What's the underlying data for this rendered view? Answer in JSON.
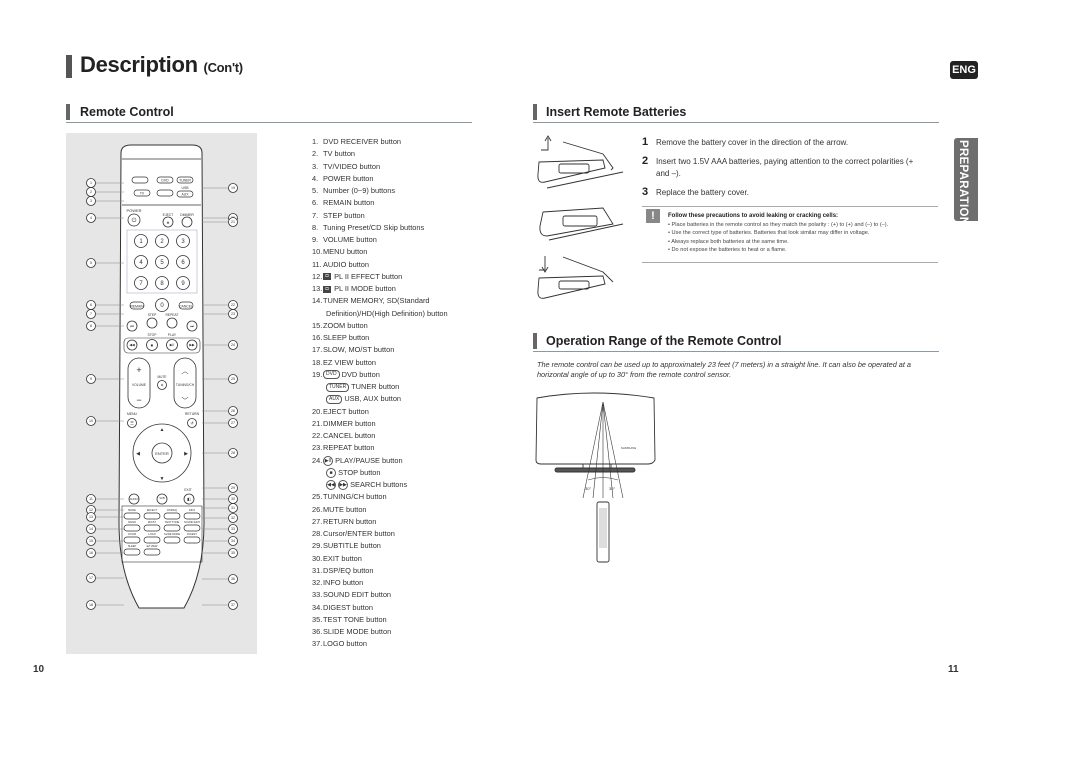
{
  "page": {
    "title": "Description",
    "title_suffix": "(Con't)",
    "language_badge": "ENG",
    "side_tab": "PREPARATION",
    "page_left": "10",
    "page_right": "11"
  },
  "remote_control": {
    "heading": "Remote Control",
    "callouts_left": [
      "1",
      "2",
      "3",
      "4",
      "5",
      "6",
      "7",
      "8",
      "9",
      "10",
      "11",
      "12",
      "13",
      "14",
      "15",
      "16",
      "17",
      "18"
    ],
    "callouts_right": [
      "19",
      "20",
      "21",
      "22",
      "23",
      "24",
      "25",
      "26",
      "27",
      "28",
      "29",
      "30",
      "31",
      "32",
      "33",
      "34",
      "35",
      "36",
      "37"
    ],
    "remote_labels": {
      "top_buttons": [
        "DVD",
        "TUNER",
        "USB",
        "AUX",
        "TV"
      ],
      "power": "POWER",
      "eject": "EJECT",
      "dimmer": "DIMMER",
      "digits": [
        "1",
        "2",
        "3",
        "4",
        "5",
        "6",
        "7",
        "8",
        "9",
        "0"
      ],
      "remain": "REMAIN",
      "cancel": "CANCEL",
      "step": "STEP",
      "repeat": "REPEAT",
      "stop": "STOP",
      "play": "PLAY",
      "mute": "MUTE",
      "volume": "VOLUME",
      "tuning": "TUNING/CH",
      "menu": "MENU",
      "return": "RETURN",
      "enter": "ENTER",
      "exit": "EXIT",
      "audio": "AUDIO",
      "subtitle": "SUB TITLE",
      "bottom_grid": [
        "MODE",
        "EFFECT",
        "DSP/EQ",
        "INFO",
        "SD/HD",
        "MO/ST",
        "TEST TONE",
        "SOUND EDIT",
        "ZOOM",
        "LOGO",
        "SLIDE MODE",
        "DIGEST",
        "SLEEP",
        "EZ VIEW"
      ],
      "pl2": "PL II",
      "slow": "SLOW",
      "tuner_memory": "TUNER MEMORY"
    },
    "items": [
      {
        "n": "1.",
        "text": "DVD RECEIVER button"
      },
      {
        "n": "2.",
        "text": "TV button"
      },
      {
        "n": "3.",
        "text": "TV/VIDEO button"
      },
      {
        "n": "4.",
        "text": "POWER button"
      },
      {
        "n": "5.",
        "text": "Number (0~9) buttons"
      },
      {
        "n": "6.",
        "text": "REMAIN button"
      },
      {
        "n": "7.",
        "text": "STEP button"
      },
      {
        "n": "8.",
        "text": "Tuning Preset/CD Skip buttons"
      },
      {
        "n": "9.",
        "text": "VOLUME button"
      },
      {
        "n": "10.",
        "text": "MENU button"
      },
      {
        "n": "11.",
        "text": "AUDIO button"
      },
      {
        "n": "12.",
        "text": "PL II EFFECT button",
        "icon": "dolby"
      },
      {
        "n": "13.",
        "text": "PL II MODE button",
        "icon": "dolby"
      },
      {
        "n": "14.",
        "text": "TUNER MEMORY, SD(Standard"
      },
      {
        "n": "",
        "text": "Definition)/HD(High Definition) button",
        "indent": true
      },
      {
        "n": "15.",
        "text": "ZOOM button"
      },
      {
        "n": "16.",
        "text": "SLEEP button"
      },
      {
        "n": "17.",
        "text": "SLOW, MO/ST button"
      },
      {
        "n": "18.",
        "text": "EZ VIEW button"
      },
      {
        "n": "19.",
        "text": "DVD button",
        "icon": "kbd",
        "icon_label": "DVD"
      },
      {
        "n": "",
        "text": "TUNER button",
        "icon": "kbd",
        "icon_label": "TUNER",
        "indent": true
      },
      {
        "n": "",
        "text": "USB, AUX button",
        "icon": "kbd",
        "icon_label": "AUX",
        "indent": true
      },
      {
        "n": "20.",
        "text": "EJECT button"
      },
      {
        "n": "21.",
        "text": "DIMMER button"
      },
      {
        "n": "22.",
        "text": "CANCEL button"
      },
      {
        "n": "23.",
        "text": "REPEAT button"
      },
      {
        "n": "24.",
        "text": "PLAY/PAUSE button",
        "icon": "round",
        "icon_label": "▶II"
      },
      {
        "n": "",
        "text": "STOP button",
        "icon": "round",
        "icon_label": "■",
        "indent": true
      },
      {
        "n": "",
        "text": "SEARCH buttons",
        "icon": "round2",
        "icon_label": "◀◀",
        "icon_label2": "▶▶",
        "indent": true
      },
      {
        "n": "25.",
        "text": "TUNING/CH button"
      },
      {
        "n": "26.",
        "text": "MUTE button"
      },
      {
        "n": "27.",
        "text": "RETURN button"
      },
      {
        "n": "28.",
        "text": "Cursor/ENTER button"
      },
      {
        "n": "29.",
        "text": "SUBTITLE button"
      },
      {
        "n": "30.",
        "text": "EXIT button"
      },
      {
        "n": "31.",
        "text": "DSP/EQ button"
      },
      {
        "n": "32.",
        "text": "INFO button"
      },
      {
        "n": "33.",
        "text": "SOUND EDIT button"
      },
      {
        "n": "34.",
        "text": "DIGEST button"
      },
      {
        "n": "35.",
        "text": "TEST TONE button"
      },
      {
        "n": "36.",
        "text": "SLIDE MODE button"
      },
      {
        "n": "37.",
        "text": "LOGO button"
      }
    ]
  },
  "insert_batteries": {
    "heading": "Insert Remote Batteries",
    "steps": [
      {
        "n": "1",
        "text": "Remove the battery cover in the direction of the arrow."
      },
      {
        "n": "2",
        "text": "Insert two 1.5V AAA batteries, paying attention to the correct polarities (+ and –)."
      },
      {
        "n": "3",
        "text": "Replace the battery cover."
      }
    ],
    "warning": {
      "icon": "!",
      "heading": "Follow these precautions to avoid leaking or cracking cells:",
      "bullets": [
        "• Place batteries in the remote control so they match the polarity : (+) to (+) and (–) to (–).",
        "• Use the correct type of batteries. Batteries that look similar may differ in voltage.",
        "• Always replace both batteries at the same time.",
        "• Do not expose the batteries to heat or a flame."
      ]
    }
  },
  "operation_range": {
    "heading": "Operation Range of the Remote Control",
    "body": "The remote control can be used up to approximately 23 feet (7 meters) in a straight line. It can also be operated at a horizontal angle of up to 30° from the remote control sensor.",
    "angle_left": "30°",
    "angle_right": "30°"
  }
}
